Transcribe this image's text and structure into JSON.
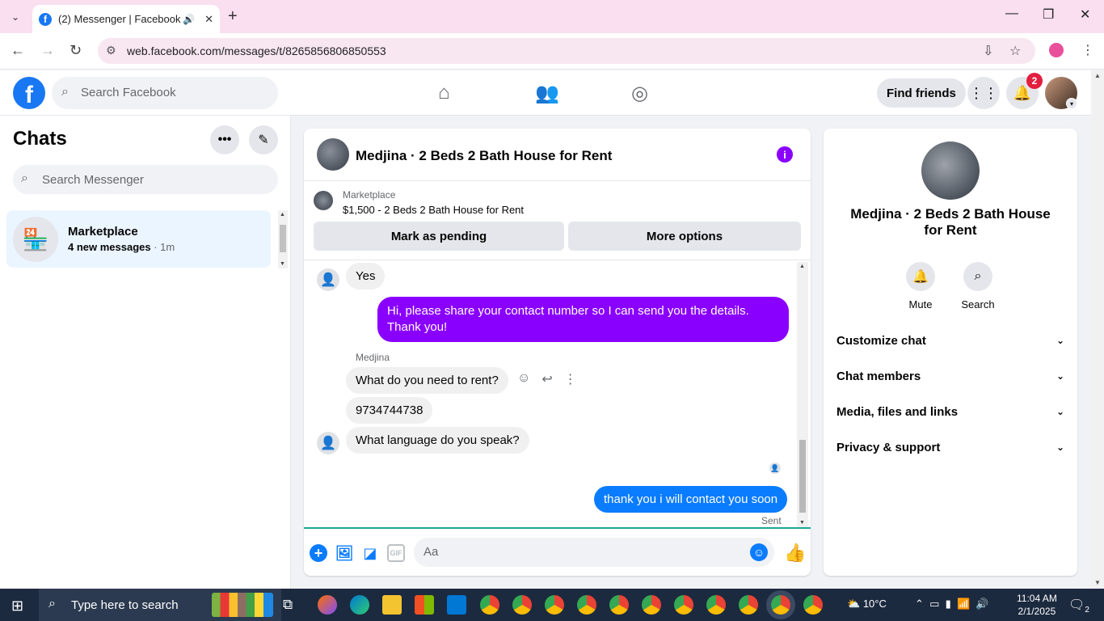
{
  "browser": {
    "tab_title": "(2) Messenger | Facebook",
    "url": "web.facebook.com/messages/t/8265856806850553"
  },
  "fb": {
    "search_placeholder": "Search Facebook",
    "find_friends": "Find friends",
    "notification_count": "2"
  },
  "chats": {
    "title": "Chats",
    "search_placeholder": "Search Messenger",
    "items": [
      {
        "name": "Marketplace",
        "preview": "4 new messages",
        "time": " · 1m"
      }
    ]
  },
  "conversation": {
    "title": "Medjina · 2 Beds 2 Bath House for Rent",
    "marketplace_label": "Marketplace",
    "listing": "$1,500 - 2 Beds 2 Bath House for Rent",
    "mark_pending": "Mark as pending",
    "more_options": "More options",
    "messages": {
      "m1": "Yes",
      "m2": "Hi, please share your contact number so I can send you the details. Thank you!",
      "sender": "Medjina",
      "m3": "What do you need to rent?",
      "m4": "9734744738",
      "m5": "What language do you speak?",
      "m6": "thank you i will contact you soon",
      "status": "Sent"
    },
    "composer_placeholder": "Aa"
  },
  "info_panel": {
    "name": "Medjina · 2 Beds 2 Bath House for Rent",
    "mute": "Mute",
    "search": "Search",
    "sections": [
      "Customize chat",
      "Chat members",
      "Media, files and links",
      "Privacy & support"
    ]
  },
  "taskbar": {
    "search_text": "Type here to search",
    "weather": "10°C",
    "time": "11:04 AM",
    "date": "2/1/2025",
    "notif_count": "2"
  },
  "colors": {
    "accent_purple": "#8a00ff",
    "messenger_blue": "#0a7cff",
    "facebook_blue": "#1877f2"
  }
}
